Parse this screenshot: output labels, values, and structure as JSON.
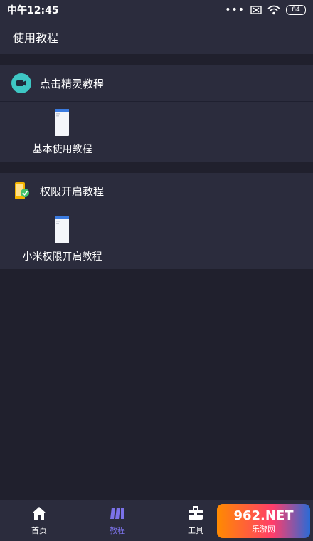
{
  "status": {
    "time": "中午12:45",
    "dots": "•••",
    "battery": "84"
  },
  "header": {
    "title": "使用教程"
  },
  "sections": [
    {
      "title": "点击精灵教程",
      "icon": "video-camera-icon",
      "item_label": "基本使用教程"
    },
    {
      "title": "权限开启教程",
      "icon": "phone-check-icon",
      "item_label": "小米权限开启教程"
    }
  ],
  "tabs": [
    {
      "label": "首页",
      "icon": "home-icon"
    },
    {
      "label": "教程",
      "icon": "book-icon"
    },
    {
      "label": "工具",
      "icon": "toolbox-icon"
    },
    {
      "label": "",
      "icon": "profile-icon"
    }
  ],
  "watermark": {
    "top": "962.NET",
    "bottom": "乐游网"
  },
  "colors": {
    "background": "#20202d",
    "panel": "#2b2c3d",
    "accent": "#7b72e8",
    "teal": "#3ec7c4"
  }
}
